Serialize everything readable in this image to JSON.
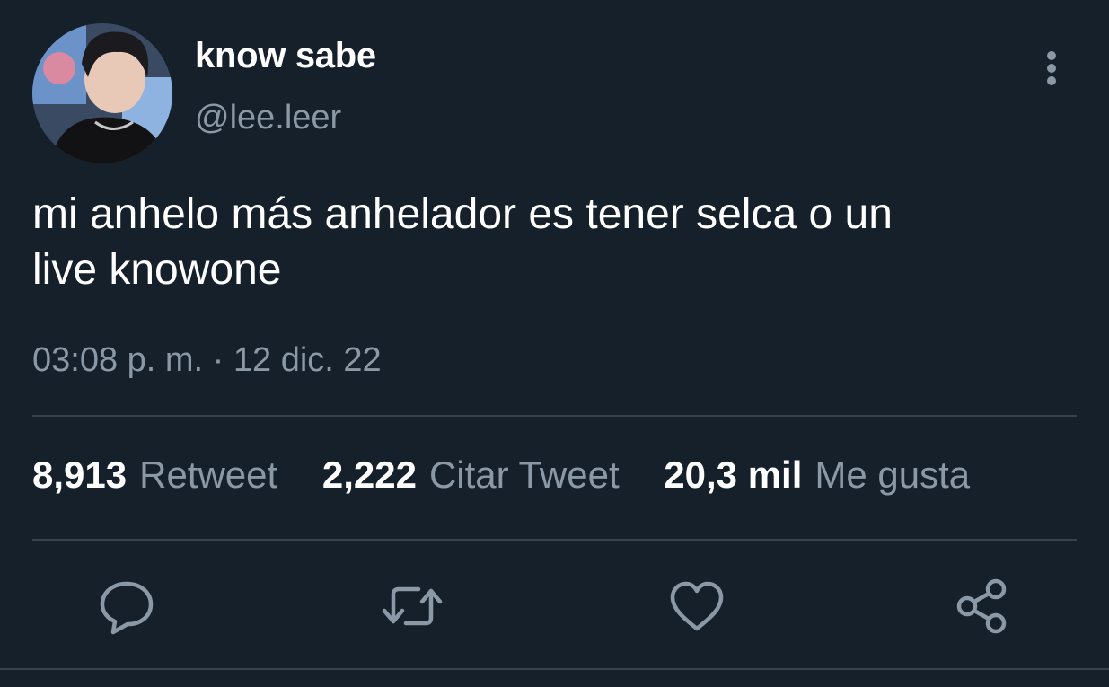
{
  "author": {
    "display_name": "know sabe",
    "handle": "@lee.leer"
  },
  "tweet": {
    "text_line1": "mi anhelo más anhelador es tener selca o un",
    "text_line2": "live knowone",
    "timestamp": "03:08 p. m. · 12 dic. 22"
  },
  "stats": {
    "retweets": {
      "count": "8,913",
      "label": "Retweet"
    },
    "quotes": {
      "count": "2,222",
      "label": "Citar Tweet"
    },
    "likes": {
      "count": "20,3 mil",
      "label": "Me gusta"
    }
  },
  "actions": {
    "reply_icon": "reply-icon",
    "retweet_icon": "retweet-icon",
    "like_icon": "heart-icon",
    "share_icon": "share-icon"
  },
  "colors": {
    "background": "#15202b",
    "secondary_text": "#8b98a5",
    "divider": "#38444d"
  }
}
